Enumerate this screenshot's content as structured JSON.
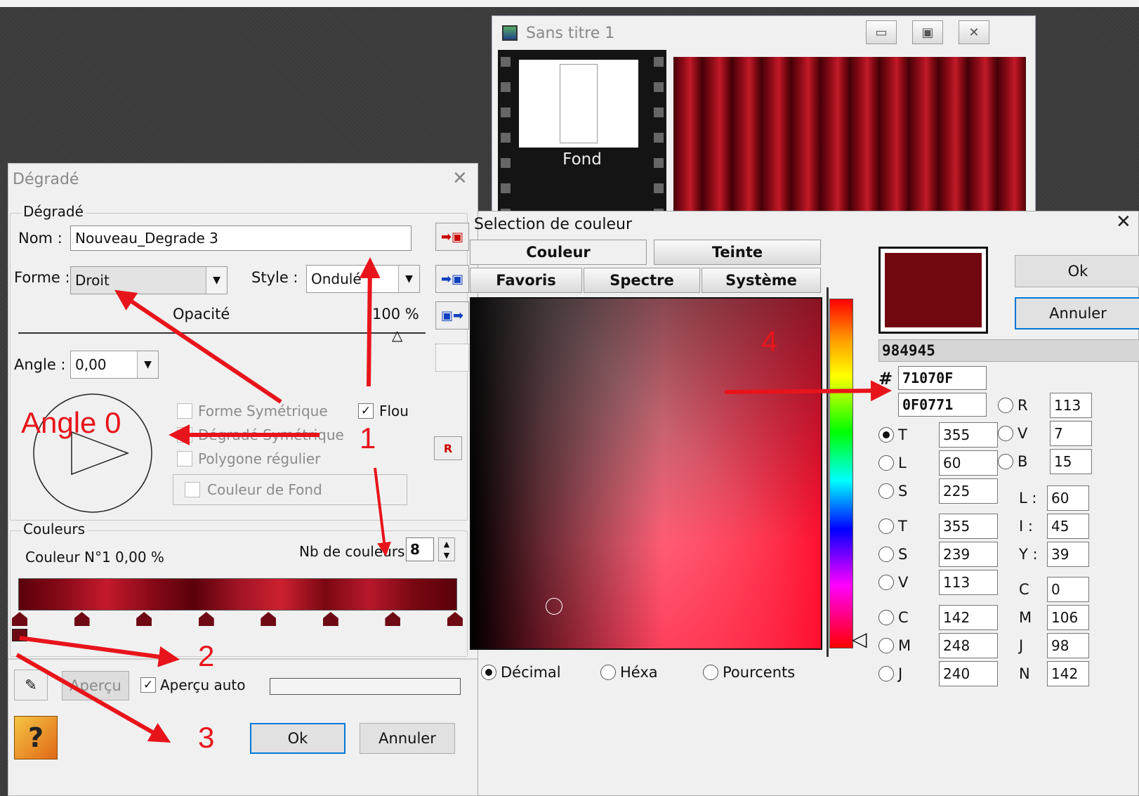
{
  "accent": "#e8141b",
  "canvas_window": {
    "title": "Sans titre 1",
    "film_item": "Fond",
    "min_icon": "minimize-icon",
    "max_icon": "maximize-icon",
    "close_icon": "close-icon"
  },
  "gradient_dialog": {
    "title": "Dégradé",
    "group_label": "Dégradé",
    "name_label": "Nom :",
    "name_value": "Nouveau_Degrade 3",
    "shape_label": "Forme :",
    "shape_value": "Droit",
    "style_label": "Style :",
    "style_value": "Ondulé",
    "opacity_label": "Opacité",
    "opacity_value": "100 %",
    "opacity_fraction": 1.0,
    "angle_label": "Angle :",
    "angle_value": "0,00",
    "checks": [
      {
        "label": "Forme Symétrique",
        "checked": false
      },
      {
        "label": "Dégradé Symétrique",
        "checked": false
      },
      {
        "label": "Polygone régulier",
        "checked": false
      }
    ],
    "flou_label": "Flou",
    "bg_color_label": "Couleur de Fond",
    "colors_group": "Couleurs",
    "color_info": "Couleur N°1 0,00 %",
    "nb_colors_label": "Nb de couleurs :",
    "nb_colors_value": "8",
    "apercu_button": "Aperçu",
    "apercu_auto_label": "Aperçu auto",
    "ok": "Ok",
    "cancel": "Annuler"
  },
  "color_dialog": {
    "title": "Selection de couleur",
    "tabs_row1": [
      "Couleur",
      "Teinte"
    ],
    "tabs_row2": [
      "Favoris",
      "Spectre",
      "Système"
    ],
    "ok": "Ok",
    "cancel": "Annuler",
    "preview_color": "#71070F",
    "code_decimal": "984945",
    "hash": "#",
    "hex_value": "71070F",
    "bgr_value": "0F0771",
    "modes": [
      "Décimal",
      "Héxa",
      "Pourcents"
    ],
    "hls": [
      {
        "label": "T",
        "value": "355",
        "selected": true
      },
      {
        "label": "L",
        "value": "60",
        "selected": false
      },
      {
        "label": "S",
        "value": "225",
        "selected": false
      }
    ],
    "hsv": [
      {
        "label": "T",
        "value": "355"
      },
      {
        "label": "S",
        "value": "239"
      },
      {
        "label": "V",
        "value": "113"
      }
    ],
    "cmy": [
      {
        "label": "C",
        "value": "142"
      },
      {
        "label": "M",
        "value": "248"
      },
      {
        "label": "J",
        "value": "240"
      }
    ],
    "rgb": [
      {
        "label": "R",
        "value": "113"
      },
      {
        "label": "V",
        "value": "7"
      },
      {
        "label": "B",
        "value": "15"
      }
    ],
    "liy": [
      {
        "label": "L :",
        "value": "60"
      },
      {
        "label": "I :",
        "value": "45"
      },
      {
        "label": "Y :",
        "value": "39"
      }
    ],
    "cmjn": [
      {
        "label": "C",
        "value": "0"
      },
      {
        "label": "M",
        "value": "106"
      },
      {
        "label": "J",
        "value": "98"
      },
      {
        "label": "N",
        "value": "142"
      }
    ]
  },
  "annotations": {
    "a1": "1",
    "a2": "2",
    "a3": "3",
    "a4": "4",
    "angle": "Angle 0"
  }
}
